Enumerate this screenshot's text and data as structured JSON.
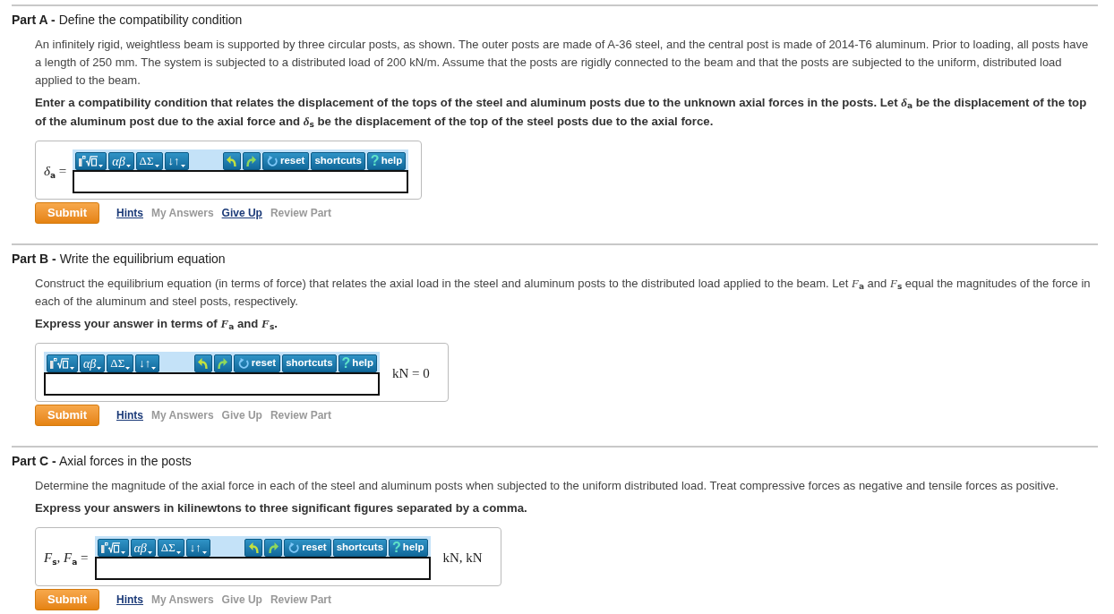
{
  "parts": [
    {
      "label": "Part A -",
      "title": "Define the compatibility condition",
      "paragraphs": [
        {
          "kind": "plain",
          "text": "An infinitely rigid, weightless beam is supported by three circular posts, as shown. The outer posts are made of A-36 steel, and the central post is made of 2014-T6 aluminum. Prior to loading, all posts have a length of 250 mm. The system is subjected to a distributed load of 200 kN/m. Assume that the posts are rigidly connected to the beam and that the posts are subjected to the uniform, distributed load applied to the beam."
        },
        {
          "kind": "instruction",
          "text": "Enter a compatibility condition that relates the displacement of the tops of the steel and aluminum posts due to the unknown axial forces in the posts. Let *δ*$_{a}$ be the displacement of the top of the aluminum post due to the axial force and *δ*$_{s}$ be the displacement of the top of the steel posts due to the axial force."
        }
      ],
      "answer": {
        "label": "*δ*$_{a}$ =",
        "menus": [
          {
            "kind": "templates"
          },
          {
            "kind": "greek",
            "label": "αβ"
          },
          {
            "kind": "operators",
            "label": "ΔΣ"
          },
          {
            "kind": "arrows",
            "label": "↓↑"
          }
        ],
        "actions": [
          {
            "kind": "undo"
          },
          {
            "kind": "redo"
          },
          {
            "kind": "reset",
            "label": "reset"
          },
          {
            "kind": "shortcuts",
            "label": "shortcuts"
          },
          {
            "kind": "help",
            "icon": "?",
            "label": "help"
          }
        ]
      },
      "submit": "Submit",
      "links": [
        {
          "label": "Hints",
          "disabled": false
        },
        {
          "label": "My Answers",
          "disabled": true
        },
        {
          "label": "Give Up",
          "disabled": false
        },
        {
          "label": "Review Part",
          "disabled": true
        }
      ]
    },
    {
      "label": "Part B -",
      "title": "Write the equilibrium equation",
      "paragraphs": [
        {
          "kind": "plain",
          "text": "Construct the equilibrium equation (in terms of force) that relates the axial load in the steel and aluminum posts to the distributed load applied to the beam. Let *F*$_{a}$ and *F*$_{s}$ equal the magnitudes of the force in each of the aluminum and steel posts, respectively."
        },
        {
          "kind": "instruction",
          "text": "Express your answer in terms of *F*$_{a}$ and *F*$_{s}$."
        }
      ],
      "answer": {
        "menus": [
          {
            "kind": "templates"
          },
          {
            "kind": "greek",
            "label": "αβ"
          },
          {
            "kind": "operators",
            "label": "ΔΣ"
          },
          {
            "kind": "arrows",
            "label": "↓↑"
          }
        ],
        "actions": [
          {
            "kind": "undo"
          },
          {
            "kind": "redo"
          },
          {
            "kind": "reset",
            "label": "reset"
          },
          {
            "kind": "shortcuts",
            "label": "shortcuts"
          },
          {
            "kind": "help",
            "icon": "?",
            "label": "help"
          }
        ],
        "units": "kN = 0"
      },
      "submit": "Submit",
      "links": [
        {
          "label": "Hints",
          "disabled": false
        },
        {
          "label": "My Answers",
          "disabled": true
        },
        {
          "label": "Give Up",
          "disabled": true
        },
        {
          "label": "Review Part",
          "disabled": true
        }
      ]
    },
    {
      "label": "Part C -",
      "title": "Axial forces in the posts",
      "paragraphs": [
        {
          "kind": "plain",
          "text": "Determine the magnitude of the axial force in each of the steel and aluminum posts when subjected to the uniform distributed load. Treat compressive forces as negative and tensile forces as positive."
        },
        {
          "kind": "instruction",
          "text": "Express your answers in kilinewtons to three significant figures separated by a comma."
        }
      ],
      "answer": {
        "label": "*F*$_{s}$, *F*$_{a}$ =",
        "menus": [
          {
            "kind": "templates"
          },
          {
            "kind": "greek",
            "label": "αβ"
          },
          {
            "kind": "operators",
            "label": "ΔΣ"
          },
          {
            "kind": "arrows",
            "label": "↓↑"
          }
        ],
        "actions": [
          {
            "kind": "undo"
          },
          {
            "kind": "redo"
          },
          {
            "kind": "reset",
            "label": "reset"
          },
          {
            "kind": "shortcuts",
            "label": "shortcuts"
          },
          {
            "kind": "help",
            "icon": "?",
            "label": "help"
          }
        ],
        "units": "kN, kN"
      },
      "submit": "Submit",
      "links": [
        {
          "label": "Hints",
          "disabled": false
        },
        {
          "label": "My Answers",
          "disabled": true
        },
        {
          "label": "Give Up",
          "disabled": true
        },
        {
          "label": "Review Part",
          "disabled": true
        }
      ]
    }
  ]
}
